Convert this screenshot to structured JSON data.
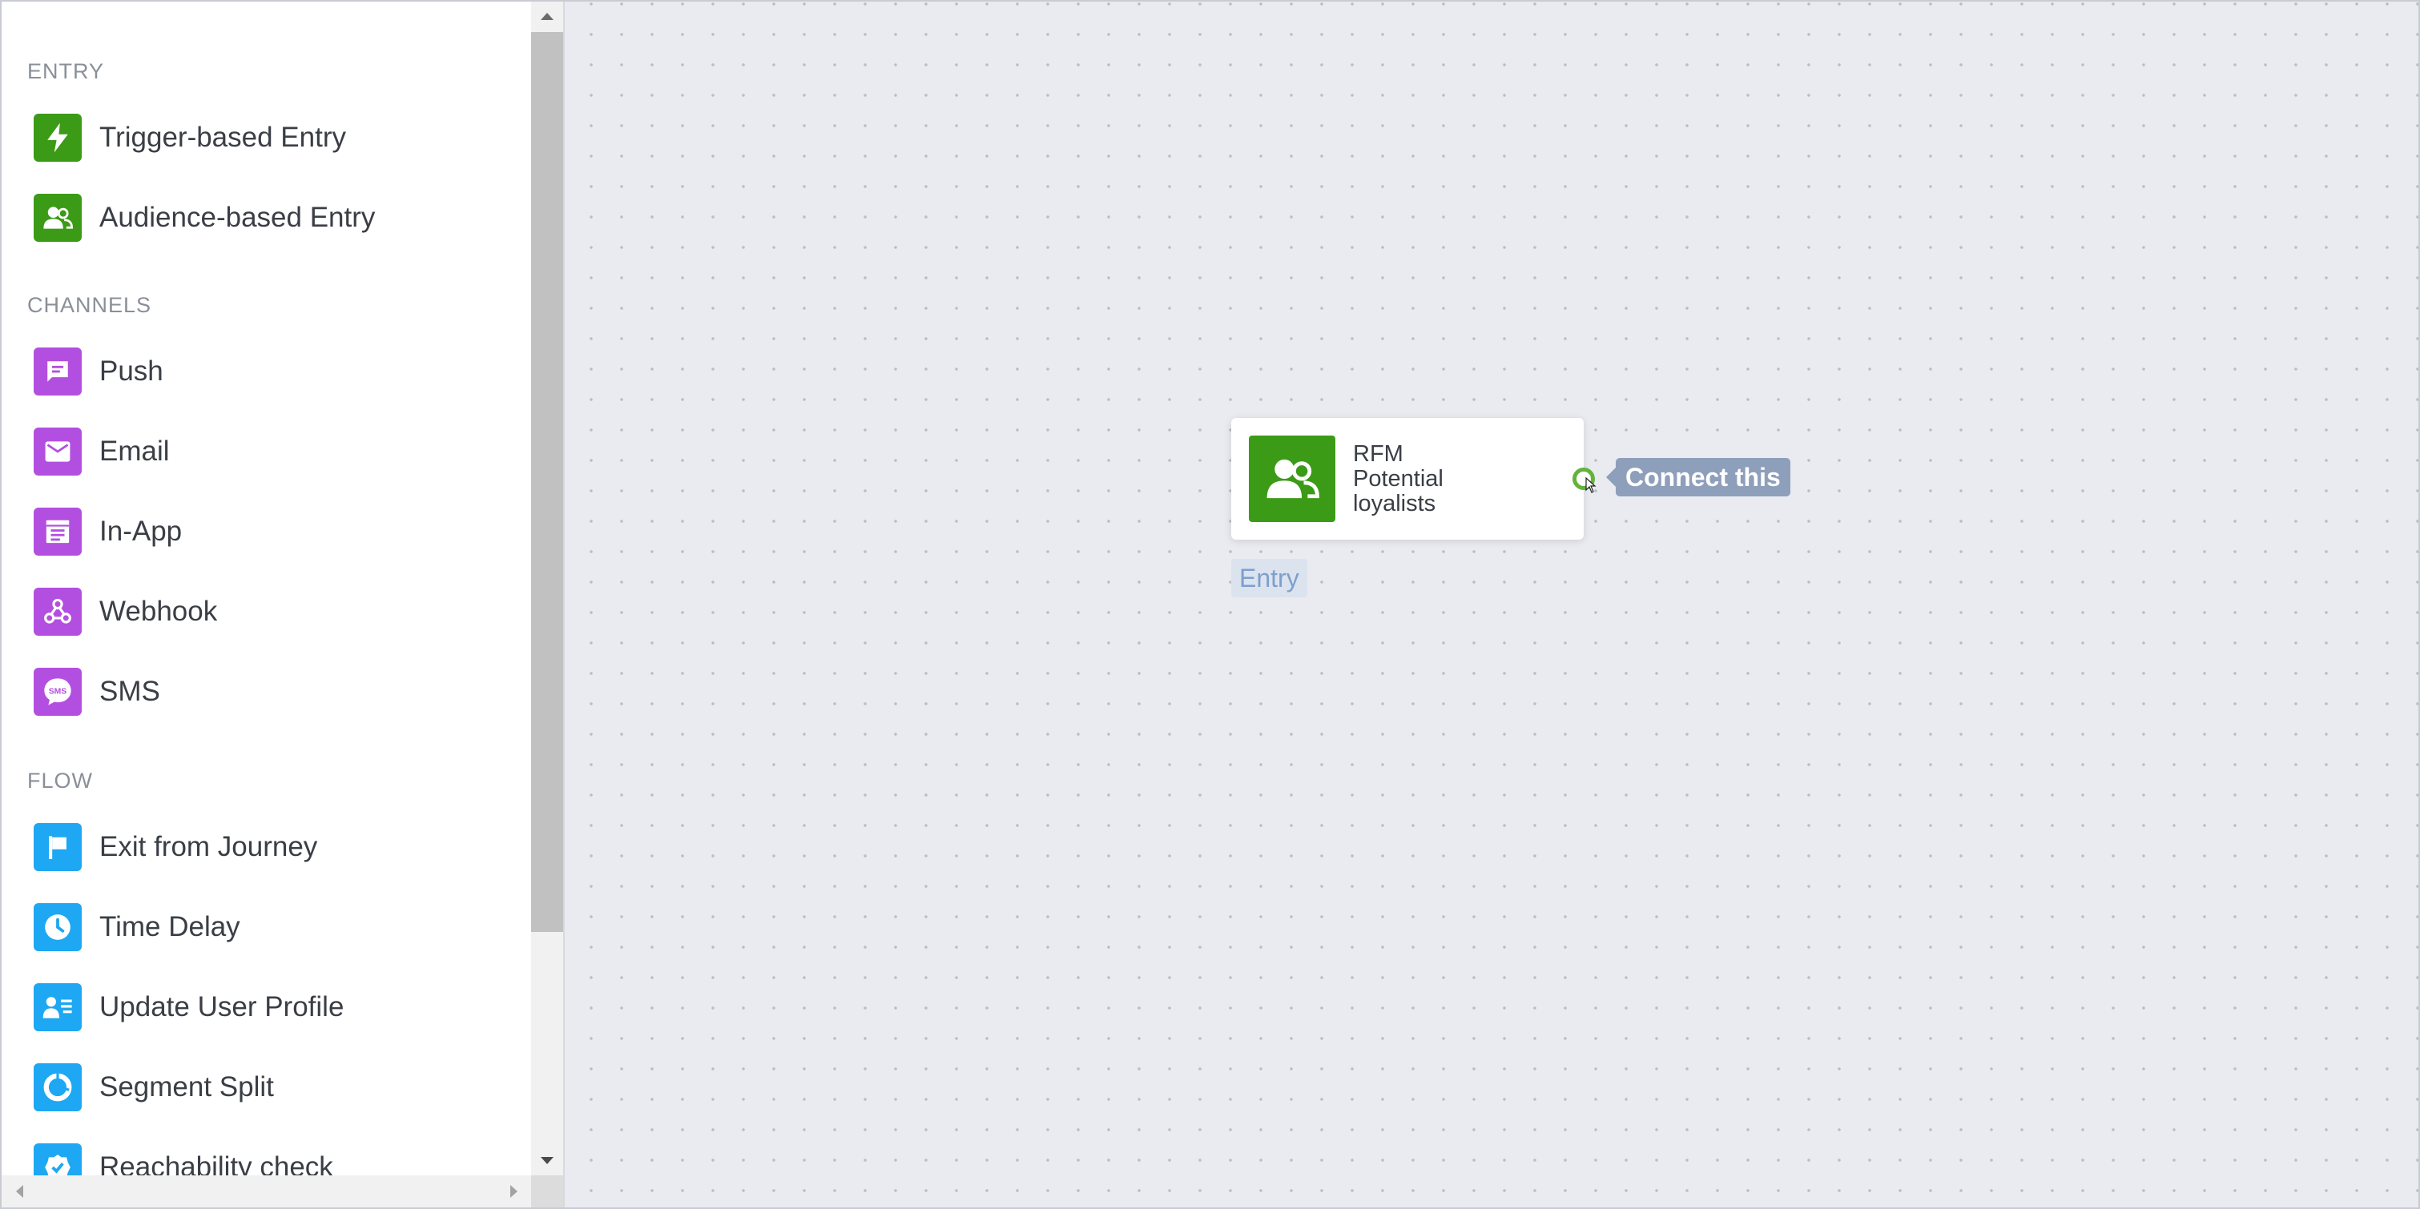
{
  "sidebar": {
    "sections": [
      {
        "title": "ENTRY",
        "items": [
          {
            "label": "Trigger-based Entry",
            "icon": "lightning-icon",
            "color": "#3b9b16"
          },
          {
            "label": "Audience-based Entry",
            "icon": "users-icon",
            "color": "#3b9b16"
          }
        ]
      },
      {
        "title": "CHANNELS",
        "items": [
          {
            "label": "Push",
            "icon": "message-icon",
            "color": "#b34fe0"
          },
          {
            "label": "Email",
            "icon": "envelope-icon",
            "color": "#b34fe0"
          },
          {
            "label": "In-App",
            "icon": "in-app-icon",
            "color": "#b34fe0"
          },
          {
            "label": "Webhook",
            "icon": "webhook-icon",
            "color": "#b34fe0"
          },
          {
            "label": "SMS",
            "icon": "sms-icon",
            "color": "#b34fe0"
          }
        ]
      },
      {
        "title": "FLOW",
        "items": [
          {
            "label": "Exit from Journey",
            "icon": "flag-icon",
            "color": "#1ea7f2"
          },
          {
            "label": "Time Delay",
            "icon": "clock-icon",
            "color": "#1ea7f2"
          },
          {
            "label": "Update User Profile",
            "icon": "user-profile-icon",
            "color": "#1ea7f2"
          },
          {
            "label": "Segment Split",
            "icon": "pie-chart-icon",
            "color": "#1ea7f2"
          },
          {
            "label": "Reachability check",
            "icon": "check-badge-icon",
            "color": "#1ea7f2"
          }
        ]
      }
    ]
  },
  "canvas": {
    "node": {
      "title_lines": [
        "RFM",
        "Potential",
        "loyalists"
      ],
      "icon": "users-icon",
      "color": "#3b9b16"
    },
    "tooltip": "Connect this",
    "node_label": "Entry"
  },
  "colors": {
    "entry": "#3b9b16",
    "channels": "#b34fe0",
    "flow": "#1ea7f2",
    "tooltip_bg": "#8e9fbb",
    "canvas_bg": "#e9ebf0"
  }
}
